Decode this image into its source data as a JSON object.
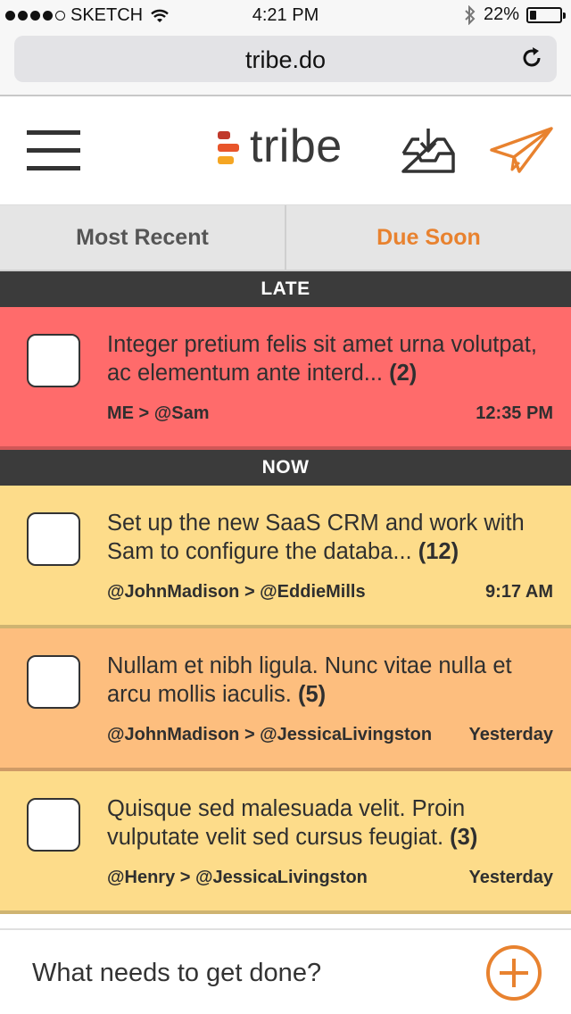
{
  "status_bar": {
    "carrier": "SKETCH",
    "time": "4:21 PM",
    "battery_text": "22%",
    "battery_level": 0.22
  },
  "browser": {
    "url": "tribe.do"
  },
  "header": {
    "logo_text": "tribe",
    "logo_colors": [
      "#c0392b",
      "#e8552b",
      "#f5a623"
    ]
  },
  "tabs": [
    {
      "label": "Most Recent",
      "color": "#555555",
      "active": false
    },
    {
      "label": "Due Soon",
      "color": "#e8822f",
      "active": true
    }
  ],
  "sections": {
    "late": {
      "label": "LATE"
    },
    "now": {
      "label": "NOW"
    }
  },
  "tasks": [
    {
      "title": "Integer pretium felis sit amet urna volutpat, ac elementum ante interd...",
      "count": "(2)",
      "route": "ME > @Sam",
      "time": "12:35 PM",
      "bg": "#ff6b6b"
    },
    {
      "title": "Set up the new SaaS CRM and work with Sam to configure the databa...",
      "count": "(12)",
      "route": "@JohnMadison > @EddieMills",
      "time": "9:17 AM",
      "bg": "#fddc8a"
    },
    {
      "title": "Nullam et nibh ligula. Nunc vitae nulla et arcu mollis iaculis.",
      "count": "(5)",
      "route": "@JohnMadison > @JessicaLivingston",
      "time": "Yesterday",
      "bg": "#fdbe7e"
    },
    {
      "title": "Quisque sed malesuada velit. Proin vulputate velit sed cursus feugiat.",
      "count": "(3)",
      "route": "@Henry > @JessicaLivingston",
      "time": "Yesterday",
      "bg": "#fddc8a"
    }
  ],
  "composer": {
    "placeholder": "What needs to get done?"
  },
  "colors": {
    "accent": "#e8822f",
    "section_bg": "#3b3b3b"
  }
}
